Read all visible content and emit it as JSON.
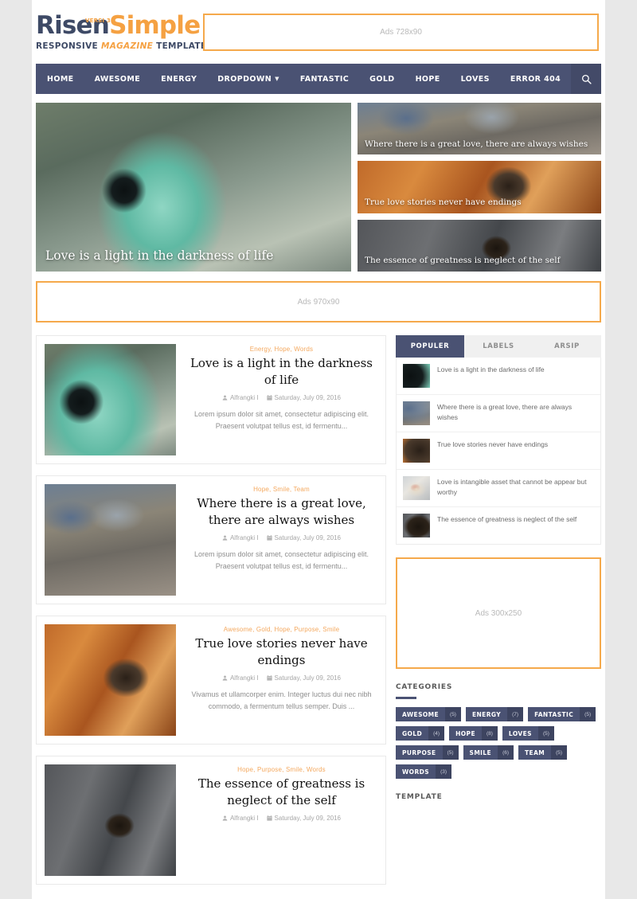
{
  "site": {
    "logo_part1": "Rise",
    "logo_part2": "n",
    "logo_part3": "Simple",
    "logo_versi": "VERSI 3",
    "tagline_1": "RESPONSIVE ",
    "tagline_mag": "MAGAZINE",
    "tagline_2": " TEMPLATE"
  },
  "ads": {
    "top": "Ads 728x90",
    "mid": "Ads 970x90",
    "sidebar": "Ads 300x250"
  },
  "nav": {
    "items": [
      {
        "label": "HOME",
        "has_caret": false
      },
      {
        "label": "AWESOME",
        "has_caret": false
      },
      {
        "label": "ENERGY",
        "has_caret": false
      },
      {
        "label": "DROPDOWN",
        "has_caret": true
      },
      {
        "label": "FANTASTIC",
        "has_caret": false
      },
      {
        "label": "GOLD",
        "has_caret": false
      },
      {
        "label": "HOPE",
        "has_caret": false
      },
      {
        "label": "LOVES",
        "has_caret": false
      },
      {
        "label": "ERROR 404",
        "has_caret": false
      }
    ],
    "search_icon": "search-icon"
  },
  "featured": {
    "main": {
      "title": "Love is a light in the darkness of life"
    },
    "side": [
      {
        "title": "Where there is a great love, there are always wishes"
      },
      {
        "title": "True love stories never have endings"
      },
      {
        "title": "The essence of greatness is neglect of the self"
      }
    ]
  },
  "posts": [
    {
      "categories": "Energy, Hope, Words",
      "title": "Love is a light in the darkness of life",
      "author": "Alfrangki I",
      "date": "Saturday, July 09, 2016",
      "excerpt": "Lorem ipsum dolor sit amet, consectetur adipiscing elit. Praesent volutpat tellus est, id fermentu..."
    },
    {
      "categories": "Hope, Smile, Team",
      "title": "Where there is a great love, there are always wishes",
      "author": "Alfrangki I",
      "date": "Saturday, July 09, 2016",
      "excerpt": "Lorem ipsum dolor sit amet, consectetur adipiscing elit. Praesent volutpat tellus est, id fermentu..."
    },
    {
      "categories": "Awesome, Gold, Hope, Purpose, Smile",
      "title": "True love stories never have endings",
      "author": "Alfrangki I",
      "date": "Saturday, July 09, 2016",
      "excerpt": "Vivamus et ullamcorper enim. Integer luctus dui nec nibh commodo, a fermentum tellus semper. Duis ..."
    },
    {
      "categories": "Hope, Purpose, Smile, Words",
      "title": "The essence of greatness is neglect of the self",
      "author": "Alfrangki I",
      "date": "Saturday, July 09, 2016",
      "excerpt": ""
    }
  ],
  "sidebar": {
    "tabs": [
      {
        "label": "POPULER",
        "active": true
      },
      {
        "label": "LABELS",
        "active": false
      },
      {
        "label": "ARSIP",
        "active": false
      }
    ],
    "popular": [
      {
        "title": "Love is a light in the darkness of life"
      },
      {
        "title": "Where there is a great love, there are always wishes"
      },
      {
        "title": "True love stories never have endings"
      },
      {
        "title": "Love is intangible asset that cannot be appear but worthy"
      },
      {
        "title": "The essence of greatness is neglect of the self"
      }
    ],
    "categories_title": "CATEGORIES",
    "categories": [
      {
        "name": "AWESOME",
        "count": "(5)"
      },
      {
        "name": "ENERGY",
        "count": "(7)"
      },
      {
        "name": "FANTASTIC",
        "count": "(5)"
      },
      {
        "name": "GOLD",
        "count": "(4)"
      },
      {
        "name": "HOPE",
        "count": "(8)"
      },
      {
        "name": "LOVES",
        "count": "(5)"
      },
      {
        "name": "PURPOSE",
        "count": "(5)"
      },
      {
        "name": "SMILE",
        "count": "(6)"
      },
      {
        "name": "TEAM",
        "count": "(5)"
      },
      {
        "name": "WORDS",
        "count": "(3)"
      }
    ],
    "bottom_widget_title": "TEMPLATE"
  },
  "colors": {
    "nav": "#4a5273",
    "accent_orange": "#f5a94b",
    "category_orange": "#f4a85e"
  }
}
